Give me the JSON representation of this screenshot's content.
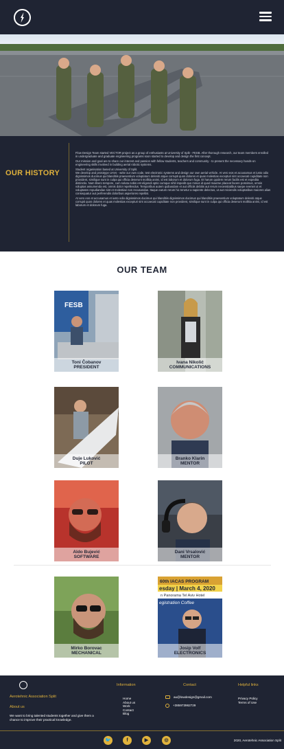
{
  "header": {
    "menu_icon": "hamburger-icon",
    "logo_icon": "compass-logo-icon"
  },
  "history": {
    "title": "OUR HISTORY",
    "paragraphs": [
      "Flow Design Team started VECTOR project as a group of enthusiasts at University of Split - FESB. After thorough research, our team members enrolled in undergraduate and graduate engineering programs soon started to develop and design the first concept.",
      "Our mission and goal are to share our interest and passion with fellow students, teachers and community - to present the necessary hands-on engineering skills involved in building aerial robotic systems.",
      "Student organisation based at University of Split.",
      "We develop and prototype UAVs - write our own code, test electronic systems and design our own aerial vehicle. At vero eos et accusamus et iusto odio dignissimos ducimus qui blanditiis praesentium voluptatum deleniti atque corrupti quos dolores et quas molestias excepturi sint occaecati cupiditate non provident, similique sunt in culpa qui officia deserunt mollitia animi, id est laborum et dolorum fuga. Et harum quidem rerum facilis est et expedita distinctio. Nam libero tempore, cum soluta nobis est eligendi optio cumque nihil impedit quo minus id quod maxime placeat facere possimus, omnis voluptas assumenda est, omnis dolor repellendus. Temporibus autem quibusdam et aut officiis debitis aut rerum necessitatibus saepe eveniet ut et voluptates repudiandae sint et molestiae non recusandae. Itaque earum rerum hic tenetur a sapiente delectus, ut aut reiciendis voluptatibus maiores alias consequatur aut perferendis doloribus asperiores repellat.",
      "At vero eos et accusamus et iusto odio dignissimos ducimus qui blanditiis dignissimos ducimus qui blanditiis praesentium voluptatum deleniti atque corrupti quos dolores et quas molestias excepturi sint occaecati cupiditate non provident, similique sunt in culpa qui officia deserunt mollitia animi, id est laborum et dolorum fuga."
    ]
  },
  "team": {
    "title": "OUR TEAM",
    "members": [
      {
        "name": "Toni Čobanov",
        "role": "PRESIDENT"
      },
      {
        "name": "Ivana Nikolić",
        "role": "COMMUNICATIONS"
      },
      {
        "name": "Duje Luković",
        "role": "PILOT"
      },
      {
        "name": "Branko Klarin",
        "role": "MENTOR"
      },
      {
        "name": "Aldo Bujević",
        "role": "SOFTWARE"
      },
      {
        "name": "Dani Vrsalović",
        "role": "MENTOR"
      },
      {
        "name": "Mirko Borovac",
        "role": "MECHANICAL"
      },
      {
        "name": "Josip Volf",
        "role": "ELECTRONICS"
      }
    ],
    "photo_texts": {
      "fesb_sign": "FESB",
      "iacas_line1": "60th IACAS PROGRAM",
      "iacas_line2": "esday | March 4, 2020",
      "iacas_line3": "n Panorama Tel Aviv Hotel",
      "iacas_line4": "egistration Coffee"
    }
  },
  "footer": {
    "org_name": "Aerotehnic Association Split",
    "about_title": "About us",
    "about_text": "We want to bring talented students together and give them a chance to improve their practical knowledge.",
    "info_title": "Information",
    "info_links": [
      "Home",
      "About us",
      "Work",
      "Contact",
      "Blog"
    ],
    "contact_title": "Contact",
    "email": "au@lowdesign@gmail.com",
    "phone": "+385973962729",
    "help_title": "Helpful links",
    "help_links": [
      "Privacy Policy",
      "Terms of Use"
    ],
    "social": [
      {
        "icon": "twitter-icon",
        "glyph": "🐦"
      },
      {
        "icon": "facebook-icon",
        "glyph": "f"
      },
      {
        "icon": "youtube-icon",
        "glyph": "▶"
      },
      {
        "icon": "instagram-icon",
        "glyph": "◎"
      }
    ],
    "copyright": "2020, Aerotehnic Association Split"
  },
  "colors": {
    "navy": "#1f2433",
    "gold": "#e0b23c"
  }
}
